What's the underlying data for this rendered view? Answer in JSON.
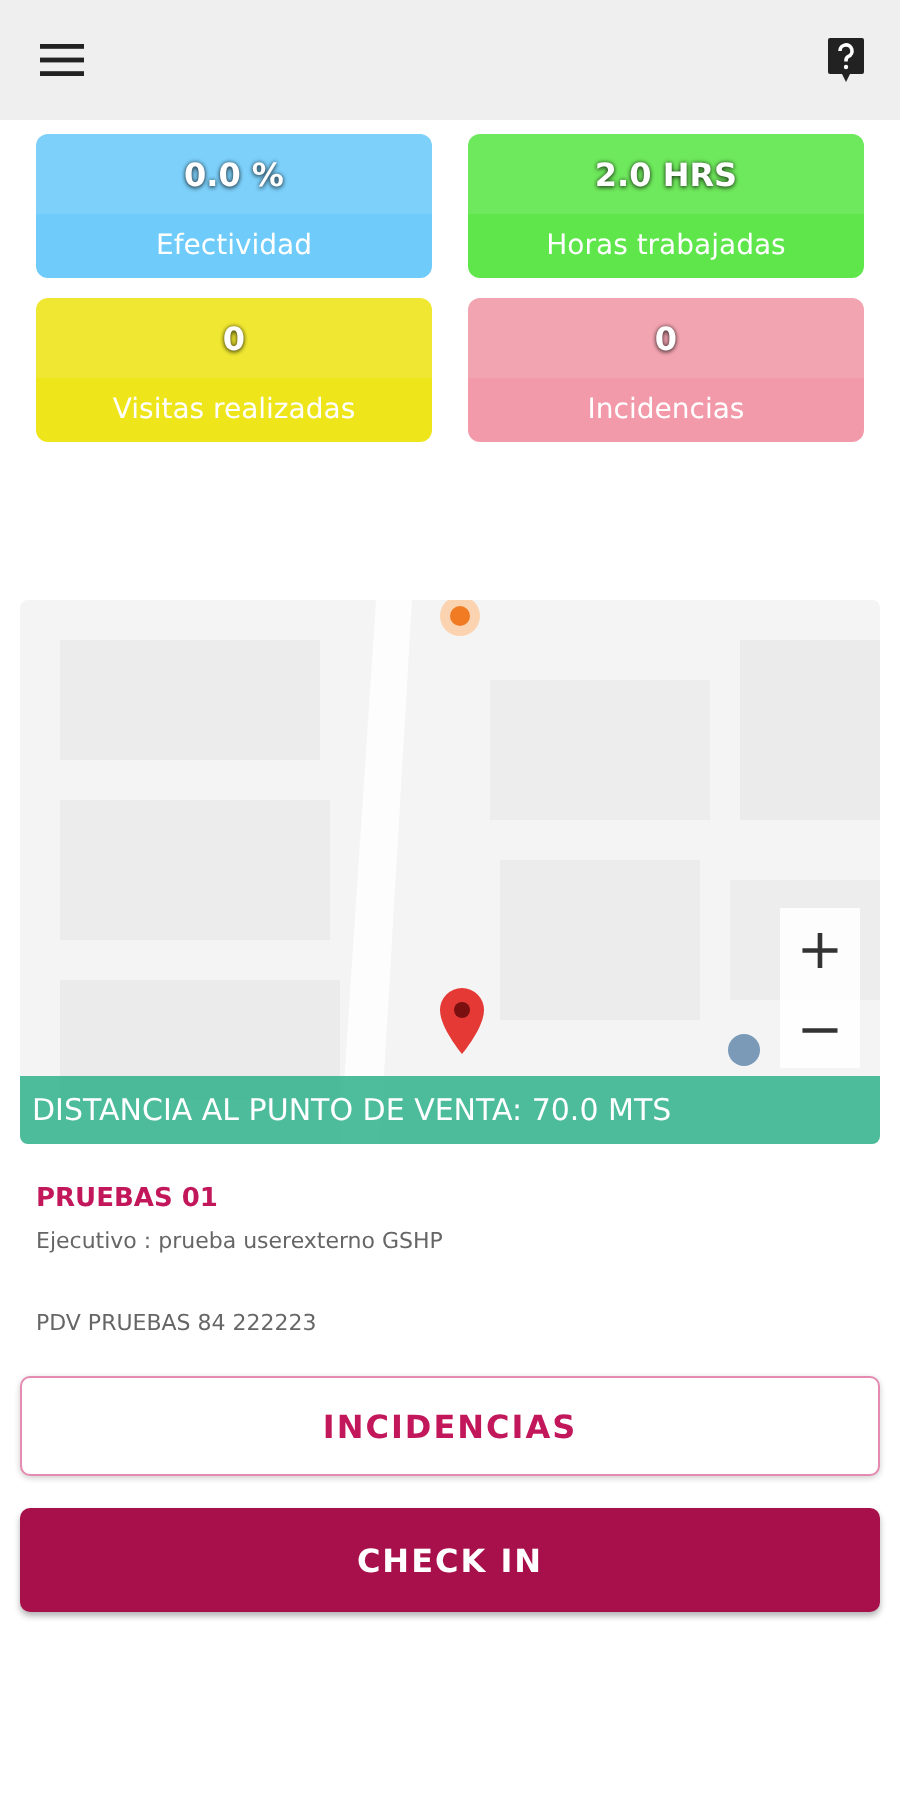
{
  "stats": [
    {
      "value": "0.0 %",
      "label": "Efectividad",
      "color": "#6ecbfa"
    },
    {
      "value": "2.0 HRS",
      "label": "Horas trabajadas",
      "color": "#5ee64a"
    },
    {
      "value": "0",
      "label": "Visitas realizadas",
      "color": "#eee51a"
    },
    {
      "value": "0",
      "label": "Incidencias",
      "color": "#f29aa9"
    }
  ],
  "map": {
    "kind": "picture",
    "zoom_in": "+",
    "zoom_out": "−",
    "distance": "DISTANCIA AL PUNTO DE VENTA: 70.0 MTS"
  },
  "store": {
    "name": "PRUEBAS 01",
    "executive": "Ejecutivo : prueba userexterno GSHP",
    "pdv": "PDV PRUEBAS 84 222223"
  },
  "buttons": [
    {
      "label": "INCIDENCIAS",
      "kind": "outline"
    },
    {
      "label": "CHECK IN",
      "kind": "filled"
    }
  ]
}
